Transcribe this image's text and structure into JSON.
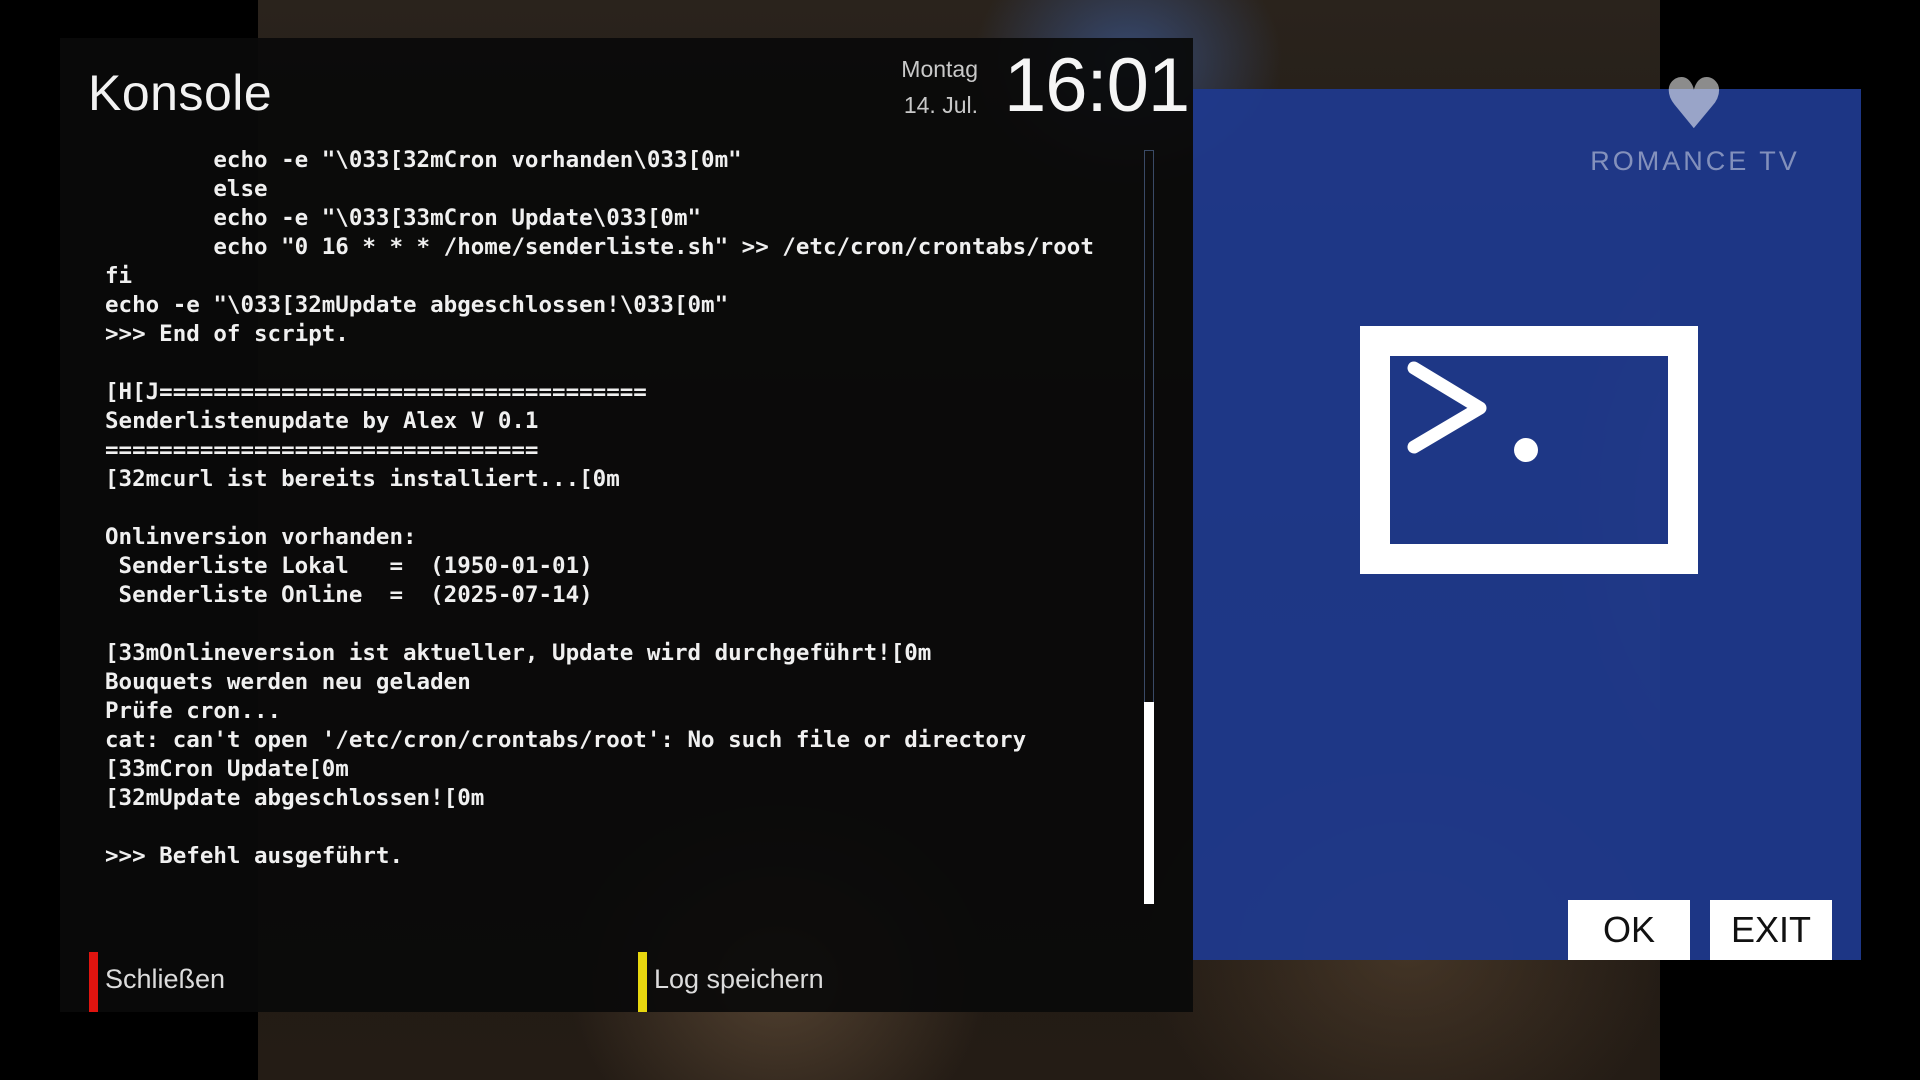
{
  "window": {
    "title": "Konsole"
  },
  "clock": {
    "day": "Montag",
    "date": "14. Jul.",
    "time": "16:01"
  },
  "console": {
    "lines": [
      "        echo -e \"\\033[32mCron vorhanden\\033[0m\"",
      "        else",
      "        echo -e \"\\033[33mCron Update\\033[0m\"",
      "        echo \"0 16 * * * /home/senderliste.sh\" >> /etc/cron/crontabs/root",
      "fi",
      "echo -e \"\\033[32mUpdate abgeschlossen!\\033[0m\"",
      ">>> End of script.",
      "",
      "[H[J====================================",
      "Senderlistenupdate by Alex V 0.1",
      "================================",
      "[32mcurl ist bereits installiert...[0m",
      "",
      "Onlinversion vorhanden:",
      " Senderliste Lokal   =  (1950-01-01)",
      " Senderliste Online  =  (2025-07-14)",
      "",
      "[33mOnlineversion ist aktueller, Update wird durchgeführt![0m",
      "Bouquets werden neu geladen",
      "Prüfe cron...",
      "cat: can't open '/etc/cron/crontabs/root': No such file or directory",
      "[33mCron Update[0m",
      "[32mUpdate abgeschlossen![0m",
      "",
      ">>> Befehl ausgeführt."
    ],
    "scroll_position": 0.73
  },
  "footer": {
    "red_label": "Schließen",
    "red_color": "#e0140f",
    "yellow_label": "Log speichern",
    "yellow_color": "#e8d70f"
  },
  "channel": {
    "name": "ROMANCE TV"
  },
  "side_panel": {
    "icon": "terminal-prompt-icon",
    "background_color": "#1f398c",
    "ok_label": "OK",
    "exit_label": "EXIT"
  }
}
